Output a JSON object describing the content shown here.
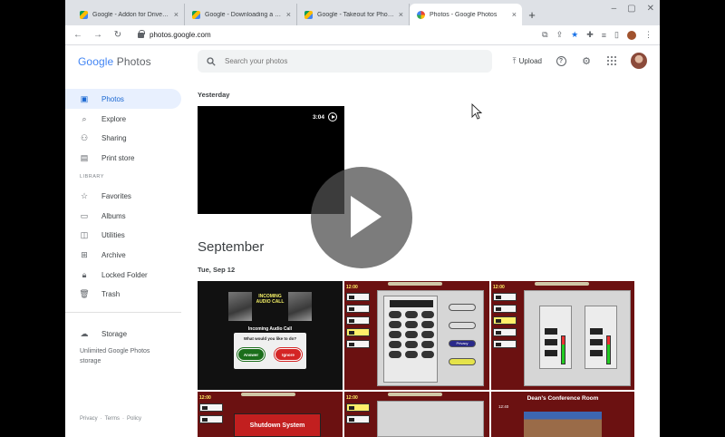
{
  "browser": {
    "tabs": [
      {
        "title": "Google - Addon for Drive incr",
        "favicon": "drive",
        "active": false
      },
      {
        "title": "Google - Downloading a Shar",
        "favicon": "drive",
        "active": false
      },
      {
        "title": "Google - Takeout for Photos",
        "favicon": "drive",
        "active": false
      },
      {
        "title": "Photos - Google Photos",
        "favicon": "photos",
        "active": true
      }
    ],
    "url": "photos.google.com"
  },
  "header": {
    "logo_google": "Google",
    "logo_photos": "Photos",
    "search_placeholder": "Search your photos",
    "upload_label": "Upload"
  },
  "sidebar": {
    "items": [
      {
        "label": "Photos",
        "icon": "photos-icon",
        "active": true
      },
      {
        "label": "Explore",
        "icon": "search-icon"
      },
      {
        "label": "Sharing",
        "icon": "people-icon"
      },
      {
        "label": "Print store",
        "icon": "print-store-icon"
      }
    ],
    "library_label": "LIBRARY",
    "library_items": [
      {
        "label": "Favorites",
        "icon": "star-icon"
      },
      {
        "label": "Albums",
        "icon": "album-icon"
      },
      {
        "label": "Utilities",
        "icon": "utilities-icon"
      },
      {
        "label": "Archive",
        "icon": "archive-icon"
      },
      {
        "label": "Locked Folder",
        "icon": "lock-icon"
      },
      {
        "label": "Trash",
        "icon": "trash-icon"
      }
    ],
    "storage_label": "Storage",
    "storage_text": "Unlimited Google Photos storage",
    "footer": [
      "Privacy",
      "Terms",
      "Policy"
    ]
  },
  "main": {
    "yesterday_label": "Yesterday",
    "video_duration": "3:04",
    "month_label": "September",
    "date_label": "Tue, Sep 12",
    "photo1": {
      "title": "INCOMING AUDIO CALL",
      "subtitle": "Incoming Audio Call",
      "question": "What would you like to do?",
      "answer": "Answer",
      "ignore": "Ignore"
    },
    "photo2": {
      "time": "12:00",
      "privacy": "Privacy"
    },
    "photo3": {
      "time": "12:00"
    },
    "photo4": {
      "time": "12:00",
      "button": "Shutdown System"
    },
    "photo5": {
      "time": "12:00"
    },
    "photo6": {
      "title": "Dean's Conference Room",
      "time": "12:40"
    }
  }
}
